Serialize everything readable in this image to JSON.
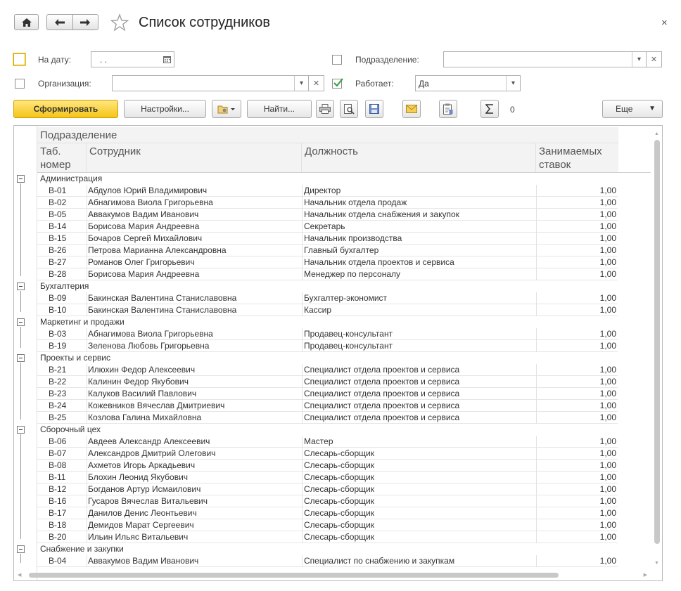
{
  "window": {
    "title": "Список сотрудников",
    "close": "×"
  },
  "filters": {
    "date_label": "На дату:",
    "date_value": ". .",
    "org_label": "Организация:",
    "org_value": "",
    "dept_label": "Подразделение:",
    "dept_value": "",
    "working_label": "Работает:",
    "working_value": "Да",
    "working_checked": true
  },
  "toolbar": {
    "generate": "Сформировать",
    "settings": "Настройки...",
    "find": "Найти...",
    "sum_value": "0",
    "more": "Еще"
  },
  "report": {
    "group_header": "Подразделение",
    "col_tab_line1": "Таб.",
    "col_tab_line2": "номер",
    "col_employee": "Сотрудник",
    "col_position": "Должность",
    "col_rate_line1": "Занимаемых",
    "col_rate_line2": "ставок",
    "groups": [
      {
        "name": "Администрация",
        "rows": [
          [
            "В-01",
            "Абдулов Юрий Владимирович",
            "Директор",
            "1,00"
          ],
          [
            "В-02",
            "Абнагимова Виола Григорьевна",
            "Начальник отдела продаж",
            "1,00"
          ],
          [
            "В-05",
            "Аввакумов Вадим Иванович",
            "Начальник отдела снабжения и закупок",
            "1,00"
          ],
          [
            "В-14",
            "Борисова Мария Андреевна",
            "Секретарь",
            "1,00"
          ],
          [
            "В-15",
            "Бочаров Сергей Михайлович",
            "Начальник производства",
            "1,00"
          ],
          [
            "В-26",
            "Петрова Марианна Александровна",
            "Главный бухгалтер",
            "1,00"
          ],
          [
            "В-27",
            "Романов Олег Григорьевич",
            "Начальник отдела проектов и сервиса",
            "1,00"
          ],
          [
            "В-28",
            "Борисова Мария Андреевна",
            "Менеджер по персоналу",
            "1,00"
          ]
        ]
      },
      {
        "name": "Бухгалтерия",
        "rows": [
          [
            "В-09",
            "Бакинская Валентина Станиславовна",
            "Бухгалтер-экономист",
            "1,00"
          ],
          [
            "В-10",
            "Бакинская Валентина Станиславовна",
            "Кассир",
            "1,00"
          ]
        ]
      },
      {
        "name": "Маркетинг и продажи",
        "rows": [
          [
            "В-03",
            "Абнагимова Виола Григорьевна",
            "Продавец-консультант",
            "1,00"
          ],
          [
            "В-19",
            "Зеленова Любовь Григорьевна",
            "Продавец-консультант",
            "1,00"
          ]
        ]
      },
      {
        "name": "Проекты и сервис",
        "rows": [
          [
            "В-21",
            "Илюхин Федор Алексеевич",
            "Специалист отдела проектов и сервиса",
            "1,00"
          ],
          [
            "В-22",
            "Калинин Федор Якубович",
            "Специалист отдела проектов и сервиса",
            "1,00"
          ],
          [
            "В-23",
            "Калуков Василий Павлович",
            "Специалист отдела проектов и сервиса",
            "1,00"
          ],
          [
            "В-24",
            "Кожевников Вячеслав Дмитриевич",
            "Специалист отдела проектов и сервиса",
            "1,00"
          ],
          [
            "В-25",
            "Козлова Галина Михайловна",
            "Специалист отдела проектов и сервиса",
            "1,00"
          ]
        ]
      },
      {
        "name": "Сборочный цех",
        "rows": [
          [
            "В-06",
            "Авдеев Александр Алексеевич",
            "Мастер",
            "1,00"
          ],
          [
            "В-07",
            "Александров Дмитрий Олегович",
            "Слесарь-сборщик",
            "1,00"
          ],
          [
            "В-08",
            "Ахметов Игорь Аркадьевич",
            "Слесарь-сборщик",
            "1,00"
          ],
          [
            "В-11",
            "Блохин Леонид Якубович",
            "Слесарь-сборщик",
            "1,00"
          ],
          [
            "В-12",
            "Богданов Артур Исмаилович",
            "Слесарь-сборщик",
            "1,00"
          ],
          [
            "В-16",
            "Гусаров Вячеслав Витальевич",
            "Слесарь-сборщик",
            "1,00"
          ],
          [
            "В-17",
            "Данилов Денис Леонтьевич",
            "Слесарь-сборщик",
            "1,00"
          ],
          [
            "В-18",
            "Демидов Марат Сергеевич",
            "Слесарь-сборщик",
            "1,00"
          ],
          [
            "В-20",
            "Ильин Ильяс Витальевич",
            "Слесарь-сборщик",
            "1,00"
          ]
        ]
      },
      {
        "name": "Снабжение и закупки",
        "rows": [
          [
            "В-04",
            "Аввакумов Вадим Иванович",
            "Специалист по снабжению и закупкам",
            "1,00"
          ]
        ]
      }
    ]
  }
}
